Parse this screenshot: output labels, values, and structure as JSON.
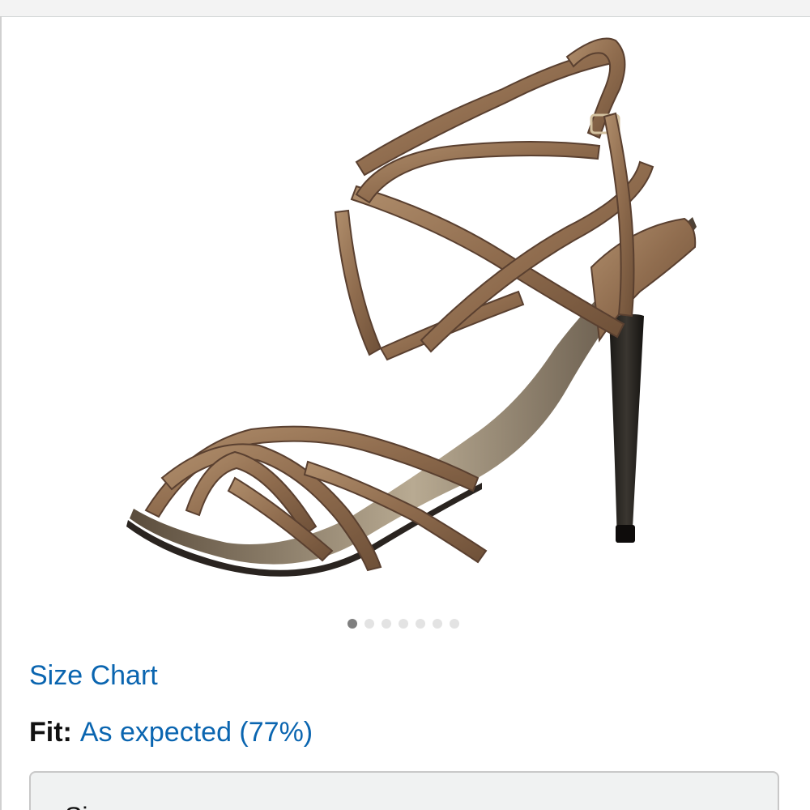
{
  "gallery": {
    "image_alt": "bronze snake-embossed strappy high heel sandal",
    "total_images": 7,
    "active_index": 0
  },
  "size_chart": {
    "label": "Size Chart"
  },
  "fit": {
    "label": "Fit:",
    "value": "As expected (77%)"
  },
  "size_selector": {
    "label": "Size:"
  },
  "colors": {
    "link": "#0a65b0",
    "dot_active": "#7f7f7f",
    "dot_inactive": "#e3e3e3"
  }
}
